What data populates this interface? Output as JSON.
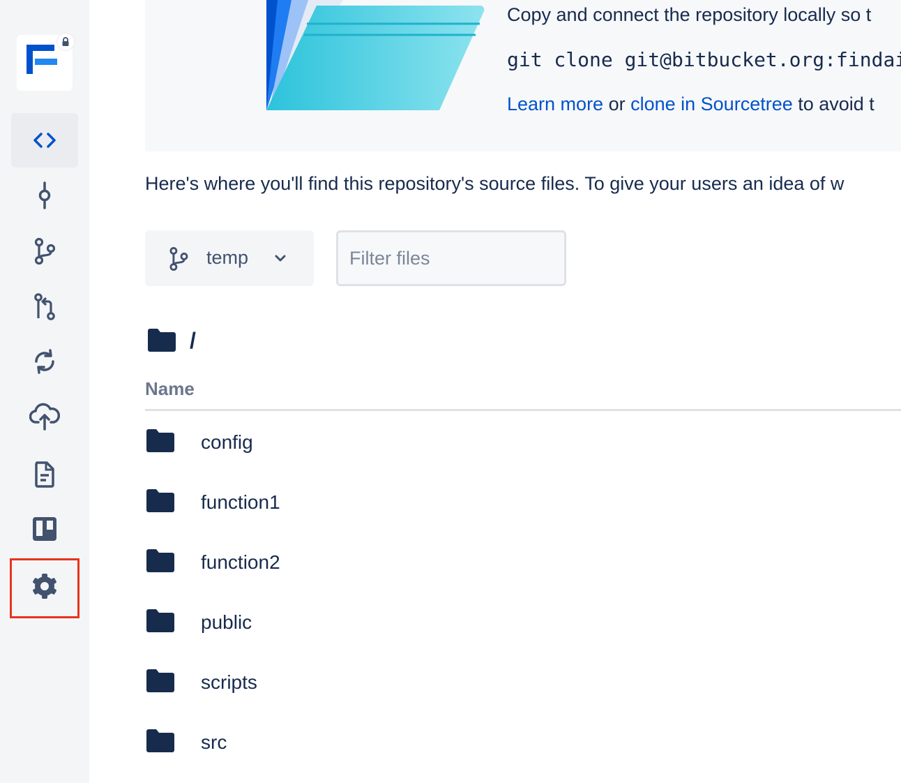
{
  "sidebar": {
    "repo_logo_icon": "repository-logo-f",
    "lock_icon": "lock-icon",
    "items": [
      {
        "name": "source",
        "icon": "code-icon",
        "active": true
      },
      {
        "name": "commits",
        "icon": "commit-icon",
        "active": false
      },
      {
        "name": "branches",
        "icon": "branch-icon",
        "active": false
      },
      {
        "name": "pull-requests",
        "icon": "pull-request-icon",
        "active": false
      },
      {
        "name": "pipelines",
        "icon": "pipelines-icon",
        "active": false
      },
      {
        "name": "deployments",
        "icon": "deployments-icon",
        "active": false
      },
      {
        "name": "downloads",
        "icon": "document-icon",
        "active": false
      },
      {
        "name": "boards",
        "icon": "trello-board-icon",
        "active": false
      },
      {
        "name": "settings",
        "icon": "gear-icon",
        "active": false,
        "highlighted": true
      }
    ]
  },
  "banner": {
    "line1": "Copy and connect the repository locally so t",
    "clone_command": "git clone git@bitbucket.org:findai",
    "learn_more": "Learn more",
    "or_text": " or ",
    "sourcetree_link": "clone in Sourcetree",
    "line3_tail": " to avoid t"
  },
  "intro_text": "Here's where you'll find this repository's source files. To give your users an idea of w",
  "branch_selector": {
    "branch": "temp",
    "icon": "branch-icon"
  },
  "filter": {
    "placeholder": "Filter files",
    "value": ""
  },
  "path": {
    "label": "/"
  },
  "table": {
    "name_header": "Name",
    "rows": [
      {
        "name": "config",
        "type": "folder"
      },
      {
        "name": "function1",
        "type": "folder"
      },
      {
        "name": "function2",
        "type": "folder"
      },
      {
        "name": "public",
        "type": "folder"
      },
      {
        "name": "scripts",
        "type": "folder"
      },
      {
        "name": "src",
        "type": "folder"
      }
    ]
  },
  "colors": {
    "accent": "#0052cc",
    "sidebar_bg": "#f4f5f7",
    "folder": "#172b4d",
    "highlight": "#e8341c"
  }
}
